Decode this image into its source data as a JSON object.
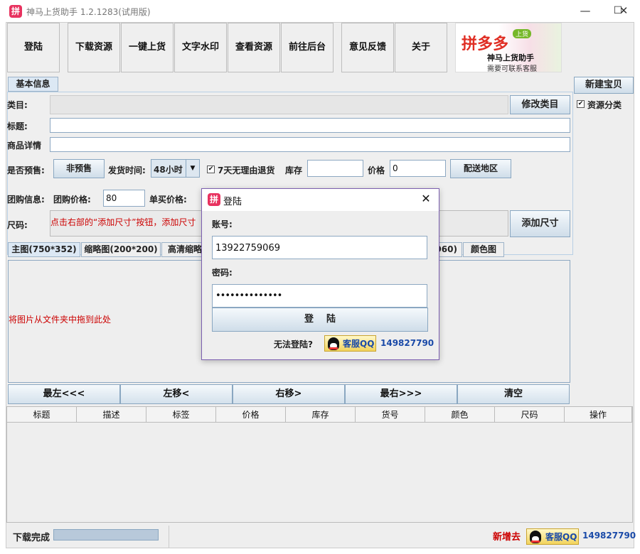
{
  "window": {
    "icon_char": "拼",
    "title": "神马上货助手 1.2.1283(试用版)",
    "minimize": "—",
    "maximize": "☐",
    "close": "✕"
  },
  "toolbar": [
    "登陆",
    "下载资源",
    "一键上货",
    "文字水印",
    "查看资源",
    "前往后台",
    "意见反馈",
    "关于"
  ],
  "ad": {
    "logo": "拼多多",
    "badge": "上货",
    "name": "神马上货助手",
    "sub": "需要可联系客服"
  },
  "right": {
    "new_item": "新建宝贝",
    "resource_category": "资源分类",
    "resource_category_checked": true
  },
  "basic_tab": "基本信息",
  "form": {
    "category_label": "类目:",
    "category_value": "",
    "edit_category": "修改类目",
    "title_label": "标题:",
    "title_value": "",
    "detail_label": "商品详情",
    "detail_value": "",
    "presale_label": "是否预售:",
    "presale_button": "非预售",
    "ship_label": "发货时间:",
    "ship_value": "48小时",
    "return_label": "7天无理由退货",
    "return_checked": true,
    "stock_label": "库存",
    "stock_value": "",
    "price_label": "价格",
    "price_value": "0",
    "delivery_button": "配送地区",
    "group_label": "团购信息:",
    "group_price_label": "团购价格:",
    "group_price_value": "80",
    "single_price_label": "单买价格:",
    "size_label": "尺码:",
    "size_hint": "点击右部的“添加尺寸”按钮，添加尺寸",
    "add_size": "添加尺寸"
  },
  "image_tabs": [
    "主图(750*352)",
    "缩略图(200*200)",
    "高清缩略",
    "960)",
    "颜色图"
  ],
  "drop_hint": "将图片从文件夹中拖到此处",
  "nav_buttons": [
    "最左<<<",
    "左移<",
    "右移>",
    "最右>>>",
    "清空"
  ],
  "table_headers": [
    "标题",
    "描述",
    "标签",
    "价格",
    "库存",
    "货号",
    "颜色",
    "尺码",
    "操作"
  ],
  "status": {
    "text": "下载完成",
    "progress": 0,
    "promo": "新增去",
    "qq_label": "客服QQ",
    "qq_number": "149827790"
  },
  "dialog": {
    "icon_char": "拼",
    "title": "登陆",
    "close": "✕",
    "account_label": "账号:",
    "account_value": "13922759069",
    "password_label": "密码:",
    "password_value": "••••••••••••••",
    "login_button": "登    陆",
    "cant_login": "无法登陆?",
    "qq_label": "客服QQ",
    "qq_number": "149827790"
  },
  "colors": {
    "accent": "#e8325f",
    "qq_blue": "#1a4aa8",
    "warning_red": "#cc0000"
  }
}
